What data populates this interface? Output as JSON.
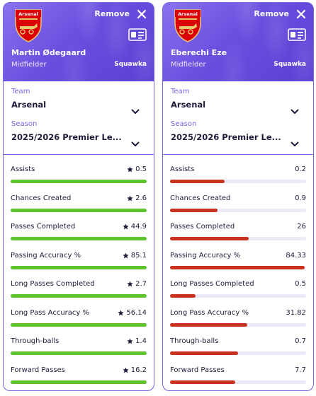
{
  "colors": {
    "accent": "#7b61e6",
    "leader": "#5ec42e",
    "trailer": "#c8321f"
  },
  "cards": [
    {
      "remove_label": "Remove",
      "player_name": "Martin Ødegaard",
      "position": "Midfielder",
      "source": "Squawka",
      "team_label": "Team",
      "team_value": "Arsenal",
      "season_label": "Season",
      "season_value": "2025/2026 Premier Le...",
      "stats": [
        {
          "label": "Assists",
          "value": "0.5",
          "leader": true,
          "fraction": 1.0
        },
        {
          "label": "Chances Created",
          "value": "2.6",
          "leader": true,
          "fraction": 1.0
        },
        {
          "label": "Passes Completed",
          "value": "44.9",
          "leader": true,
          "fraction": 1.0
        },
        {
          "label": "Passing Accuracy %",
          "value": "85.1",
          "leader": true,
          "fraction": 1.0
        },
        {
          "label": "Long Passes Completed",
          "value": "2.7",
          "leader": true,
          "fraction": 1.0
        },
        {
          "label": "Long Pass Accuracy %",
          "value": "56.14",
          "leader": true,
          "fraction": 1.0
        },
        {
          "label": "Through-balls",
          "value": "1.4",
          "leader": true,
          "fraction": 1.0
        },
        {
          "label": "Forward Passes",
          "value": "16.2",
          "leader": true,
          "fraction": 1.0
        }
      ]
    },
    {
      "remove_label": "Remove",
      "player_name": "Eberechi Eze",
      "position": "Midfielder",
      "source": "Squawka",
      "team_label": "Team",
      "team_value": "Arsenal",
      "season_label": "Season",
      "season_value": "2025/2026 Premier Le...",
      "stats": [
        {
          "label": "Assists",
          "value": "0.2",
          "leader": false,
          "fraction": 0.4
        },
        {
          "label": "Chances Created",
          "value": "0.9",
          "leader": false,
          "fraction": 0.35
        },
        {
          "label": "Passes Completed",
          "value": "26",
          "leader": false,
          "fraction": 0.58
        },
        {
          "label": "Passing Accuracy %",
          "value": "84.33",
          "leader": false,
          "fraction": 0.99
        },
        {
          "label": "Long Passes Completed",
          "value": "0.5",
          "leader": false,
          "fraction": 0.19
        },
        {
          "label": "Long Pass Accuracy %",
          "value": "31.82",
          "leader": false,
          "fraction": 0.57
        },
        {
          "label": "Through-balls",
          "value": "0.7",
          "leader": false,
          "fraction": 0.5
        },
        {
          "label": "Forward Passes",
          "value": "7.7",
          "leader": false,
          "fraction": 0.48
        }
      ]
    }
  ]
}
